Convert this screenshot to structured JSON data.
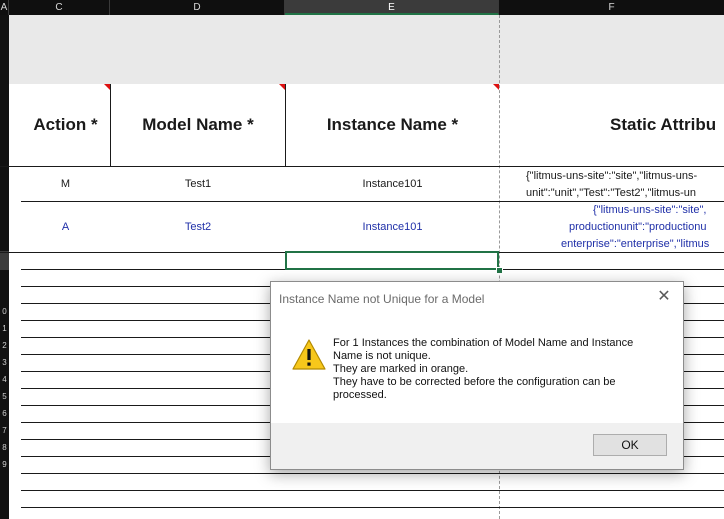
{
  "column_headers": [
    "A",
    "C",
    "D",
    "E",
    "F"
  ],
  "row_numbers": [
    "0",
    "1",
    "2",
    "3",
    "4",
    "5",
    "6",
    "7",
    "8",
    "9"
  ],
  "table": {
    "headers": [
      "Action *",
      "Model Name *",
      "Instance Name *",
      "Static Attribu"
    ],
    "rows": [
      {
        "action": "M",
        "model": "Test1",
        "instance": "Instance101",
        "static_line1": "{\"litmus-uns-site\":\"site\",\"litmus-uns-",
        "static_line2": "unit\":\"unit\",\"Test\":\"Test2\",\"litmus-un",
        "color": "#1a1a1a"
      },
      {
        "action": "A",
        "model": "Test2",
        "instance": "Instance101",
        "static_line1": "{\"litmus-uns-site\":\"site\",",
        "static_line2": "productionunit\":\"productionu",
        "static_line3": "enterprise\":\"enterprise\",\"litmus",
        "color": "#1f2fa8"
      }
    ]
  },
  "dialog": {
    "title": "Instance Name not Unique for a Model",
    "message_lines": [
      "For 1 Instances the combination of Model Name and Instance",
      "Name is not unique.",
      "They are marked in orange.",
      "They have to be corrected before the configuration can be",
      "processed."
    ],
    "ok_label": "OK",
    "icon": "warning-icon",
    "close_icon": "close-icon"
  },
  "colors": {
    "header_dark": "#0f0f0f",
    "selection_green": "#217346",
    "warning_yellow": "#f7c71b"
  }
}
